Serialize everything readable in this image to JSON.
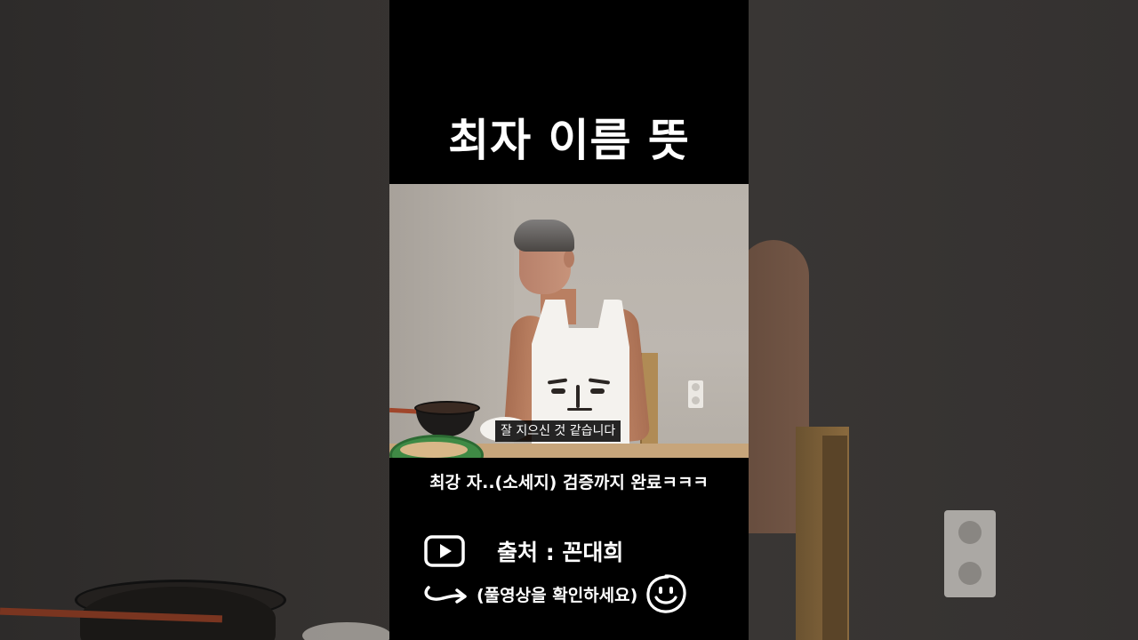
{
  "video": {
    "title": "최자 이름 뜻",
    "subtitle": "잘 지으신 것 같습니다",
    "caption": "최강 자..(소세지) 검증까지 완료ㅋㅋㅋ"
  },
  "footer": {
    "source_label": "출처 :  꼰대희",
    "full_video_label": "(풀영상을 확인하세요)"
  },
  "icons": {
    "play": "play-button-icon",
    "arrow": "curved-arrow-icon",
    "smile": "smiley-icon"
  },
  "colors": {
    "column_background": "#000000",
    "text": "#ffffff"
  }
}
